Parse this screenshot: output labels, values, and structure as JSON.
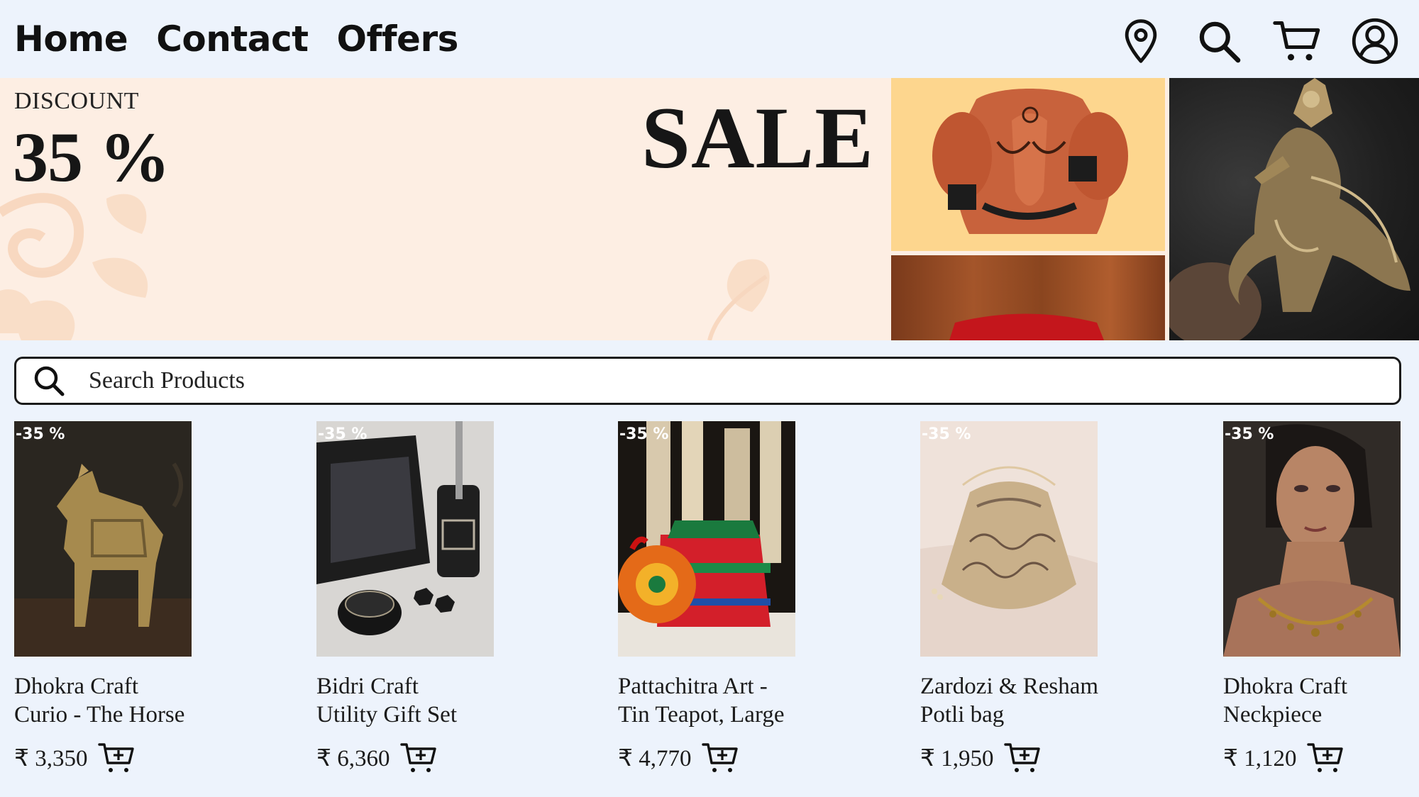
{
  "nav": {
    "links": [
      "Home",
      "Contact",
      "Offers"
    ],
    "icons": [
      "location-pin-icon",
      "search-icon",
      "cart-icon",
      "user-account-icon"
    ]
  },
  "banner": {
    "discount_label": "DISCOUNT",
    "discount_value": "35 %",
    "sale_text": "SALE",
    "images": [
      "ganesha-figurine",
      "wooden-panel-red-cushion",
      "brass-deity-statue"
    ]
  },
  "search": {
    "placeholder": "Search Products"
  },
  "products": [
    {
      "badge": "-35 %",
      "name_line1": "Dhokra Craft",
      "name_line2": "Curio - The Horse",
      "price": "₹ 3,350"
    },
    {
      "badge": "-35 %",
      "name_line1": "Bidri Craft",
      "name_line2": "Utility Gift Set",
      "price": "₹ 6,360"
    },
    {
      "badge": "-35 %",
      "name_line1": "Pattachitra Art -",
      "name_line2": "Tin Teapot, Large",
      "price": "₹ 4,770"
    },
    {
      "badge": "-35 %",
      "name_line1": "Zardozi & Resham",
      "name_line2": "Potli bag",
      "price": "₹ 1,950"
    },
    {
      "badge": "-35 %",
      "name_line1": "Dhokra Craft",
      "name_line2": "Neckpiece",
      "price": "₹ 1,120"
    }
  ],
  "colors": {
    "page_bg": "#edf3fc",
    "banner_bg": "#fdeee3",
    "text": "#111111",
    "badge_text": "#ffffff"
  }
}
